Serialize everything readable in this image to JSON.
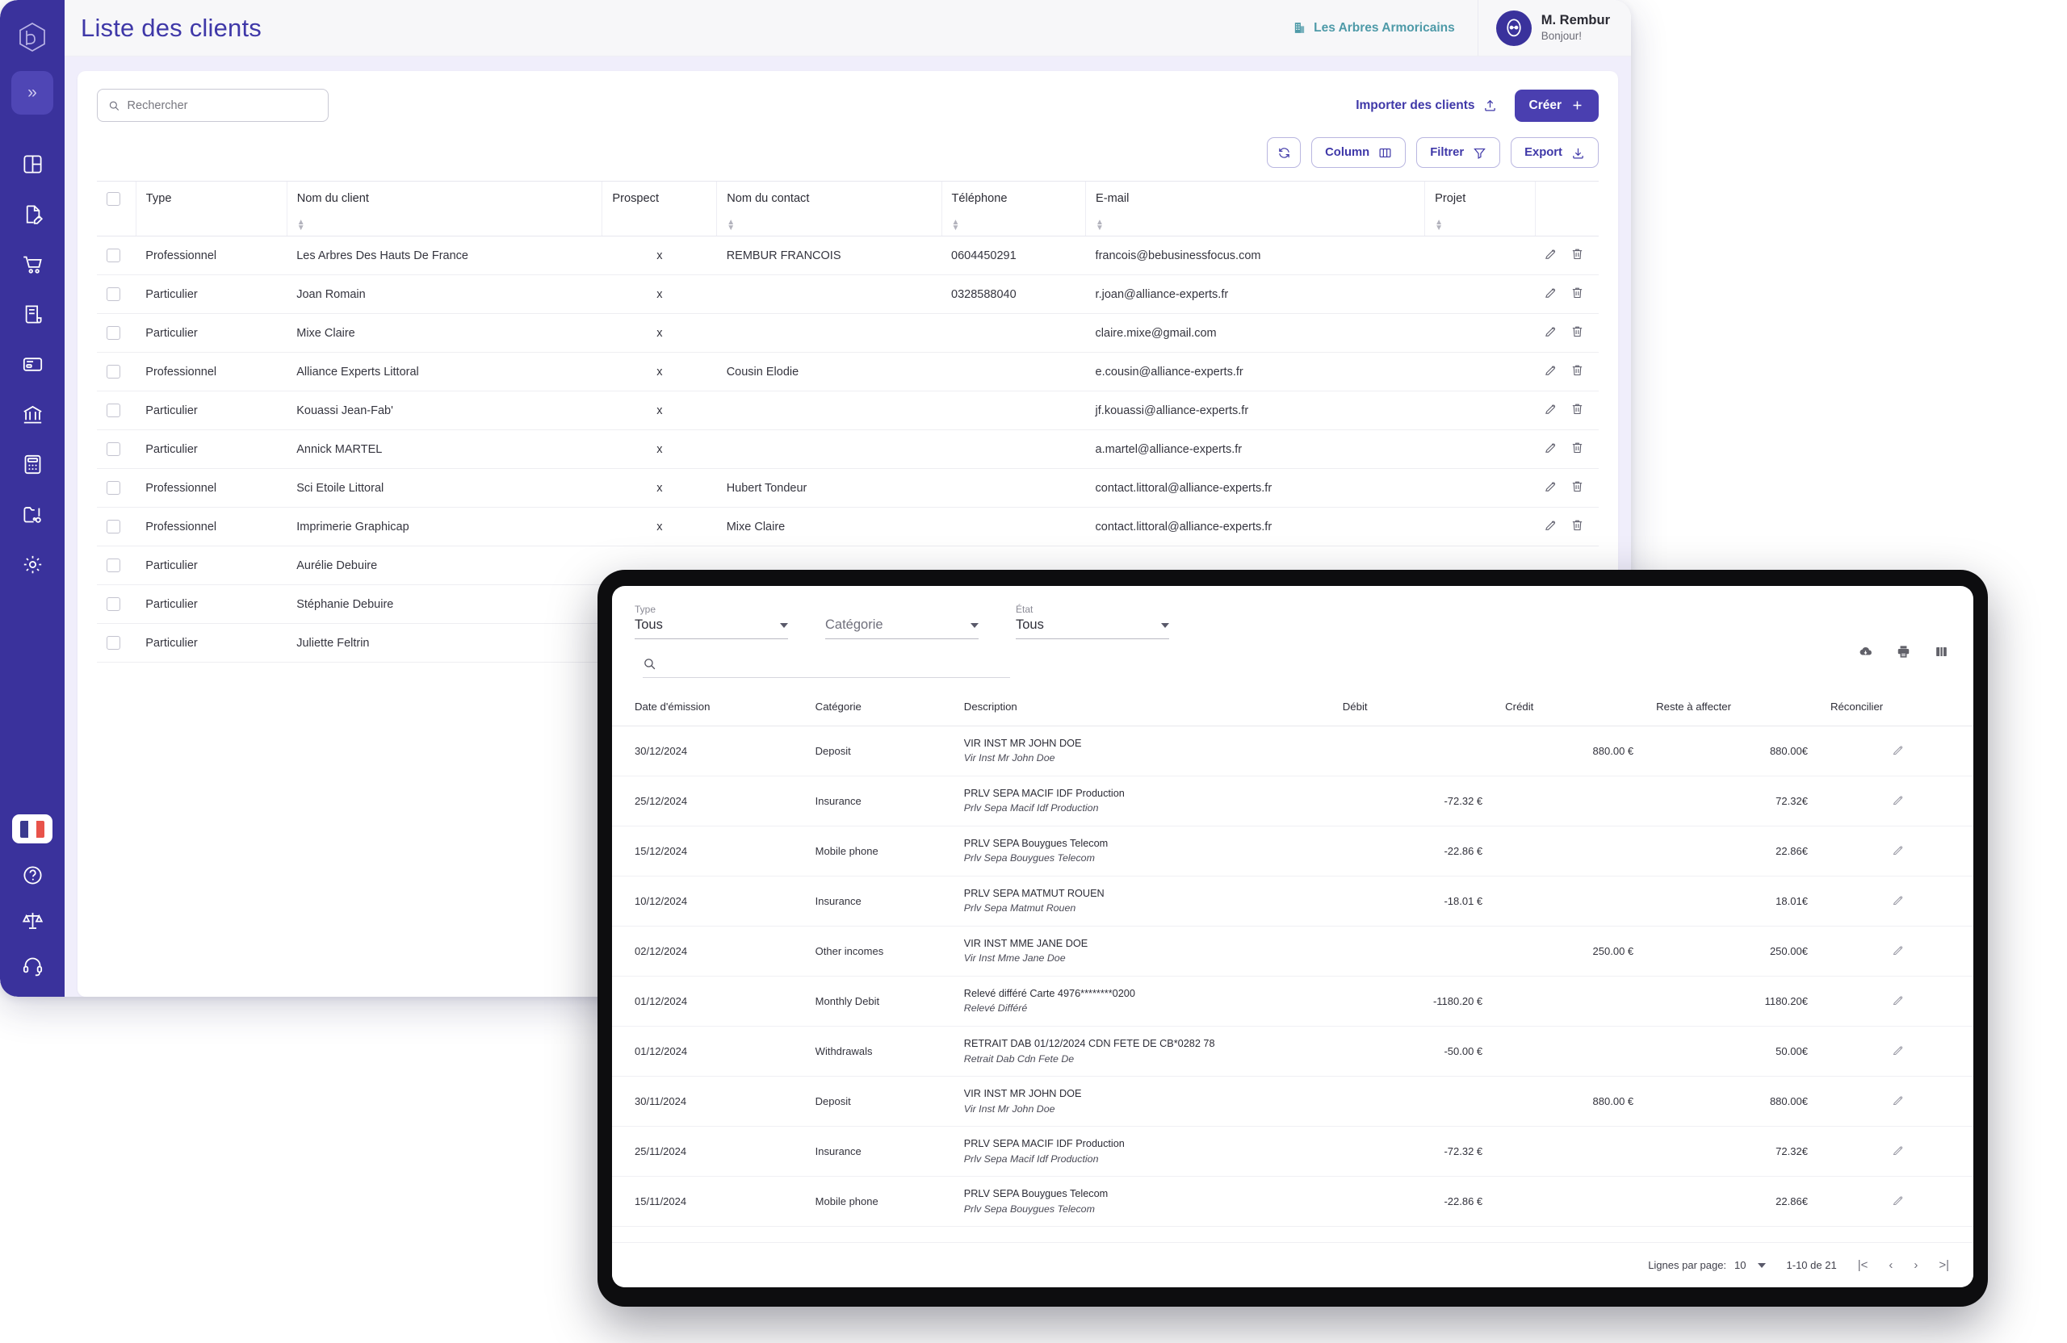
{
  "app": {
    "page_title": "Liste des clients",
    "company_name": "Les Arbres Armoricains",
    "user_name": "M. Rembur",
    "user_greeting": "Bonjour!",
    "sidebar_toggle": "»"
  },
  "sidebar": {
    "items": [
      {
        "icon": "dashboard-icon"
      },
      {
        "icon": "document-edit-icon"
      },
      {
        "icon": "shopping-cart-icon"
      },
      {
        "icon": "receipt-icon"
      },
      {
        "icon": "credit-card-icon"
      },
      {
        "icon": "bank-icon"
      },
      {
        "icon": "calculator-icon"
      },
      {
        "icon": "folder-settings-icon"
      },
      {
        "icon": "gear-icon"
      }
    ],
    "bottom_items": [
      {
        "icon": "flag-fr-icon"
      },
      {
        "icon": "help-circle-icon"
      },
      {
        "icon": "scales-legal-icon"
      },
      {
        "icon": "headset-support-icon"
      }
    ]
  },
  "toolbar": {
    "search_placeholder": "Rechercher",
    "search_value": "",
    "import_label": "Importer des clients",
    "create_label": "Créer",
    "refresh_label": "",
    "column_label": "Column",
    "filter_label": "Filtrer",
    "export_label": "Export"
  },
  "clients_table": {
    "columns": [
      "Type",
      "Nom du client",
      "Prospect",
      "Nom du contact",
      "Téléphone",
      "E-mail",
      "Projet"
    ],
    "rows": [
      {
        "type": "Professionnel",
        "client": "Les Arbres Des Hauts De France",
        "prospect": "x",
        "contact": "REMBUR FRANCOIS",
        "phone": "0604450291",
        "email": "francois@bebusinessfocus.com",
        "projet": ""
      },
      {
        "type": "Particulier",
        "client": "Joan Romain",
        "prospect": "x",
        "contact": "",
        "phone": "0328588040",
        "email": "r.joan@alliance-experts.fr",
        "projet": ""
      },
      {
        "type": "Particulier",
        "client": "Mixe Claire",
        "prospect": "x",
        "contact": "",
        "phone": "",
        "email": "claire.mixe@gmail.com",
        "projet": ""
      },
      {
        "type": "Professionnel",
        "client": "Alliance Experts Littoral",
        "prospect": "x",
        "contact": "Cousin Elodie",
        "phone": "",
        "email": "e.cousin@alliance-experts.fr",
        "projet": ""
      },
      {
        "type": "Particulier",
        "client": "Kouassi Jean-Fab'",
        "prospect": "x",
        "contact": "",
        "phone": "",
        "email": "jf.kouassi@alliance-experts.fr",
        "projet": ""
      },
      {
        "type": "Particulier",
        "client": "Annick MARTEL",
        "prospect": "x",
        "contact": "",
        "phone": "",
        "email": "a.martel@alliance-experts.fr",
        "projet": ""
      },
      {
        "type": "Professionnel",
        "client": "Sci Etoile Littoral",
        "prospect": "x",
        "contact": "Hubert Tondeur",
        "phone": "",
        "email": "contact.littoral@alliance-experts.fr",
        "projet": ""
      },
      {
        "type": "Professionnel",
        "client": "Imprimerie Graphicap",
        "prospect": "x",
        "contact": "Mixe Claire",
        "phone": "",
        "email": "contact.littoral@alliance-experts.fr",
        "projet": ""
      },
      {
        "type": "Particulier",
        "client": "Aurélie Debuire",
        "prospect": "",
        "contact": "",
        "phone": "",
        "email": "",
        "projet": ""
      },
      {
        "type": "Particulier",
        "client": "Stéphanie Debuire",
        "prospect": "",
        "contact": "",
        "phone": "",
        "email": "",
        "projet": ""
      },
      {
        "type": "Particulier",
        "client": "Juliette Feltrin",
        "prospect": "",
        "contact": "",
        "phone": "",
        "email": "",
        "projet": ""
      }
    ]
  },
  "device_panel": {
    "filters": [
      {
        "label": "Type",
        "value": "Tous",
        "is_placeholder": false
      },
      {
        "label": "",
        "value": "Catégorie",
        "is_placeholder": true
      },
      {
        "label": "État",
        "value": "Tous",
        "is_placeholder": false
      }
    ],
    "search_value": "",
    "tools": [
      "cloud-download-icon",
      "print-icon",
      "columns-icon"
    ],
    "columns": [
      "Date d'émission",
      "Catégorie",
      "Description",
      "Débit",
      "Crédit",
      "Reste à affecter",
      "Réconcilier"
    ],
    "rows": [
      {
        "date": "30/12/2024",
        "category": "Deposit",
        "desc_main": "VIR INST MR JOHN DOE",
        "desc_sub": "Vir Inst Mr John Doe",
        "debit": "",
        "credit": "880.00 €",
        "reste": "880.00€"
      },
      {
        "date": "25/12/2024",
        "category": "Insurance",
        "desc_main": "PRLV SEPA MACIF IDF Production",
        "desc_sub": "Prlv Sepa Macif Idf Production",
        "debit": "-72.32 €",
        "credit": "",
        "reste": "72.32€"
      },
      {
        "date": "15/12/2024",
        "category": "Mobile phone",
        "desc_main": "PRLV SEPA Bouygues Telecom",
        "desc_sub": "Prlv Sepa Bouygues Telecom",
        "debit": "-22.86 €",
        "credit": "",
        "reste": "22.86€"
      },
      {
        "date": "10/12/2024",
        "category": "Insurance",
        "desc_main": "PRLV SEPA MATMUT ROUEN",
        "desc_sub": "Prlv Sepa Matmut Rouen",
        "debit": "-18.01 €",
        "credit": "",
        "reste": "18.01€"
      },
      {
        "date": "02/12/2024",
        "category": "Other incomes",
        "desc_main": "VIR INST MME JANE DOE",
        "desc_sub": "Vir Inst Mme Jane Doe",
        "debit": "",
        "credit": "250.00 €",
        "reste": "250.00€"
      },
      {
        "date": "01/12/2024",
        "category": "Monthly Debit",
        "desc_main": "Relevé différé Carte 4976********0200",
        "desc_sub": "Relevé Différé",
        "debit": "-1180.20 €",
        "credit": "",
        "reste": "1180.20€"
      },
      {
        "date": "01/12/2024",
        "category": "Withdrawals",
        "desc_main": "RETRAIT DAB 01/12/2024 CDN FETE DE CB*0282 78",
        "desc_sub": "Retrait Dab Cdn Fete De",
        "debit": "-50.00 €",
        "credit": "",
        "reste": "50.00€"
      },
      {
        "date": "30/11/2024",
        "category": "Deposit",
        "desc_main": "VIR INST MR JOHN DOE",
        "desc_sub": "Vir Inst Mr John Doe",
        "debit": "",
        "credit": "880.00 €",
        "reste": "880.00€"
      },
      {
        "date": "25/11/2024",
        "category": "Insurance",
        "desc_main": "PRLV SEPA MACIF IDF Production",
        "desc_sub": "Prlv Sepa Macif Idf Production",
        "debit": "-72.32 €",
        "credit": "",
        "reste": "72.32€"
      },
      {
        "date": "15/11/2024",
        "category": "Mobile phone",
        "desc_main": "PRLV SEPA Bouygues Telecom",
        "desc_sub": "Prlv Sepa Bouygues Telecom",
        "debit": "-22.86 €",
        "credit": "",
        "reste": "22.86€"
      }
    ],
    "footer": {
      "rows_per_page_label": "Lignes par page:",
      "rows_per_page_value": "10",
      "range_label": "1-10 de 21",
      "first_icon": "|<",
      "prev_icon": "‹",
      "next_icon": "›",
      "last_icon": ">|"
    }
  },
  "colors": {
    "brand_purple": "#3a329c",
    "accent_purple": "#4a3fb0",
    "teal": "#4e9aa8",
    "content_bg": "#f0eefb",
    "danger_red": "#e8452d"
  }
}
